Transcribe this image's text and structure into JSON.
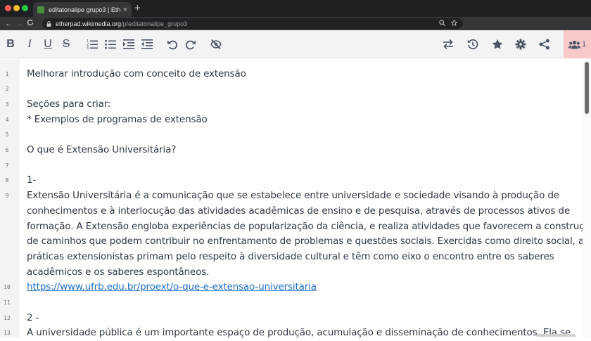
{
  "browser": {
    "tab_title": "editatonalipe grupo3 | Etherpad",
    "tab_close": "×",
    "new_tab": "+",
    "url_host": "etherpad.wikimedia.org",
    "url_path": "/p/editatonalipe_grupo3",
    "back": "←",
    "forward": "→",
    "reload": "C",
    "menu": "⋮",
    "extensions": [
      "#4a90d9",
      "#cfd2d6",
      "#cfd2d6",
      "#cfd2d6",
      "#cfd2d6",
      "#3bb54a",
      "#cfd2d6",
      "#d33"
    ]
  },
  "toolbar": {
    "bold": "B",
    "italic": "I",
    "underline": "U",
    "strikethrough": "S",
    "users_count": "1"
  },
  "editor": {
    "lines": [
      {
        "n": "1",
        "text": "Melhorar introdução com conceito de extensão"
      },
      {
        "n": "2",
        "text": ""
      },
      {
        "n": "3",
        "text": "Seções para criar:"
      },
      {
        "n": "4",
        "text": "* Exemplos de programas de extensão"
      },
      {
        "n": "5",
        "text": ""
      },
      {
        "n": "6",
        "text": "O que é Extensão Universitária?"
      },
      {
        "n": "7",
        "text": ""
      },
      {
        "n": "8",
        "text": "1-"
      },
      {
        "n": "9",
        "text": "Extensão Universitária é a comunicação que se estabelece entre universidade e sociedade visando à produção de"
      },
      {
        "n": "",
        "text": "conhecimentos e à interlocução das atividades acadêmicas de ensino e de pesquisa, através de processos ativos de"
      },
      {
        "n": "",
        "text": "formação.  A Extensão engloba experiências de popularização da ciência, e realiza atividades que favorecem a construção"
      },
      {
        "n": "",
        "text": "de caminhos que podem contribuir no enfrentamento de problemas e questões sociais. Exercidas como direito social, as"
      },
      {
        "n": "",
        "text": "práticas extensionistas primam pelo respeito à diversidade cultural e têm como eixo o encontro entre os saberes"
      },
      {
        "n": "",
        "text": "acadêmicos e os saberes espontâneos."
      },
      {
        "n": "10",
        "text": "https://www.ufrb.edu.br/proext/o-que-e-extensao-universitaria",
        "link": true
      },
      {
        "n": "11",
        "text": ""
      },
      {
        "n": "12",
        "text": "2 -"
      },
      {
        "n": "13",
        "text": "A universidade pública é um importante espaço de produção, acumulação e disseminação de conhecimentos.  Ela se"
      }
    ]
  }
}
